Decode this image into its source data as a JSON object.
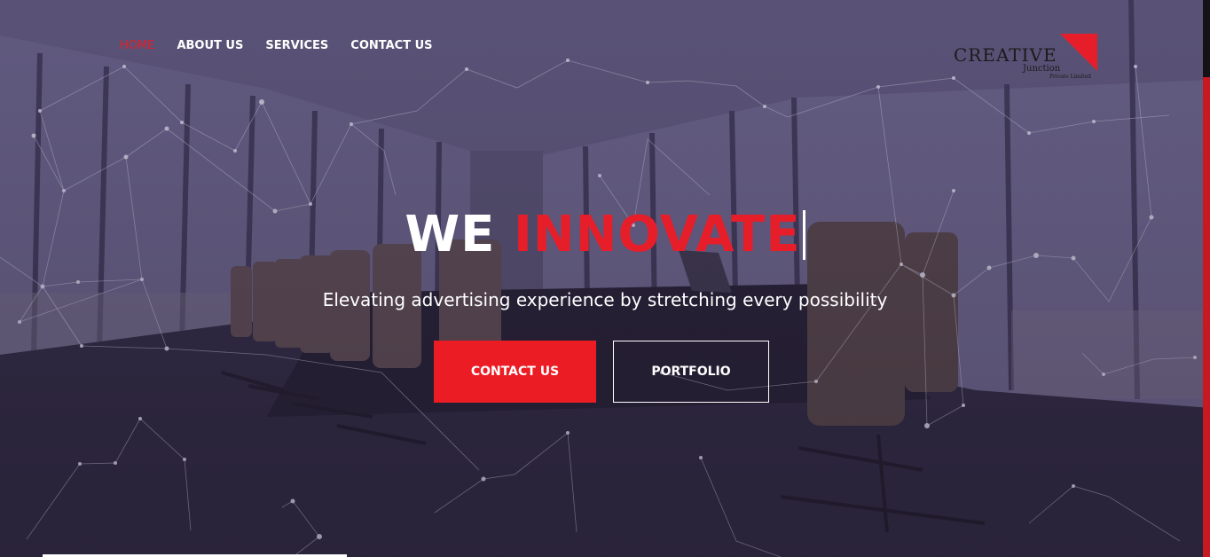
{
  "nav": {
    "items": [
      {
        "label": "HOME",
        "active": true
      },
      {
        "label": "ABOUT US",
        "active": false
      },
      {
        "label": "SERVICES",
        "active": false
      },
      {
        "label": "CONTACT US",
        "active": false
      }
    ]
  },
  "logo": {
    "name": "CREATIVE",
    "sub": "Junction",
    "sub2": "Private Limited"
  },
  "hero": {
    "headline_white": "WE",
    "headline_red": "INNOVATE",
    "subtitle": "Elevating advertising experience by stretching every possibility",
    "primary_button": "CONTACT US",
    "secondary_button": "PORTFOLIO"
  },
  "colors": {
    "accent": "#e61e2a",
    "button_red": "#ec1c24",
    "text": "#ffffff"
  }
}
